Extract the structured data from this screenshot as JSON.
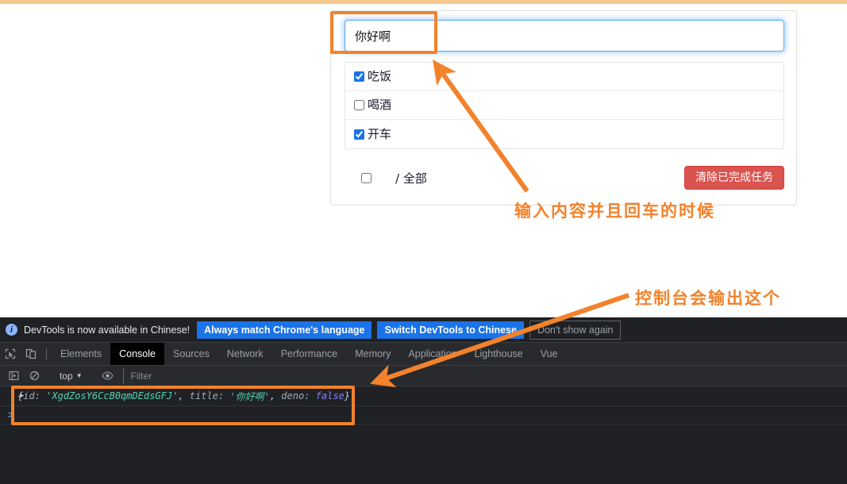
{
  "page": {
    "top_bar_color": "#f5c98e",
    "accent_orange": "#f2822c"
  },
  "todo": {
    "input": {
      "value": "你好啊",
      "placeholder": ""
    },
    "items": [
      {
        "label": "吃饭",
        "checked": true
      },
      {
        "label": "喝酒",
        "checked": false
      },
      {
        "label": "开车",
        "checked": true
      }
    ],
    "footer": {
      "toggle_all_checked": false,
      "summary": "/ 全部",
      "clear_button": "清除已完成任务",
      "clear_button_color": "#d9534f"
    }
  },
  "annotations": {
    "note_input": "输入内容并且回车的时候",
    "note_console": "控制台会输出这个"
  },
  "devtools": {
    "notice": {
      "icon": "info-icon",
      "text": "DevTools is now available in Chinese!",
      "buttons": [
        "Always match Chrome's language",
        "Switch DevTools to Chinese"
      ],
      "dismiss": "Don't show again"
    },
    "icons": {
      "inspect": "inspect-element-icon",
      "device": "device-toolbar-icon"
    },
    "tabs": [
      {
        "label": "Elements",
        "active": false
      },
      {
        "label": "Console",
        "active": true
      },
      {
        "label": "Sources",
        "active": false
      },
      {
        "label": "Network",
        "active": false
      },
      {
        "label": "Performance",
        "active": false
      },
      {
        "label": "Memory",
        "active": false
      },
      {
        "label": "Application",
        "active": false
      },
      {
        "label": "Lighthouse",
        "active": false
      },
      {
        "label": "Vue",
        "active": false
      }
    ],
    "console_bar": {
      "sidebar_icon": "show-console-sidebar-icon",
      "clear_icon": "clear-console-icon",
      "context": "top",
      "context_caret": "▼",
      "eye_icon": "live-expression-icon",
      "filter_placeholder": "Filter"
    },
    "console_output": {
      "expand_arrow": "▶",
      "open_brace": "{",
      "key_id": "id:",
      "value_id": "'XgdZosY6CcB0qmDEdsGFJ'",
      "comma_1": ", ",
      "key_title": "title:",
      "value_title": "'你好啊'",
      "comma_2": ", ",
      "key_deno": "deno:",
      "value_deno": "false",
      "close_brace": "}"
    },
    "prompt": ">"
  }
}
